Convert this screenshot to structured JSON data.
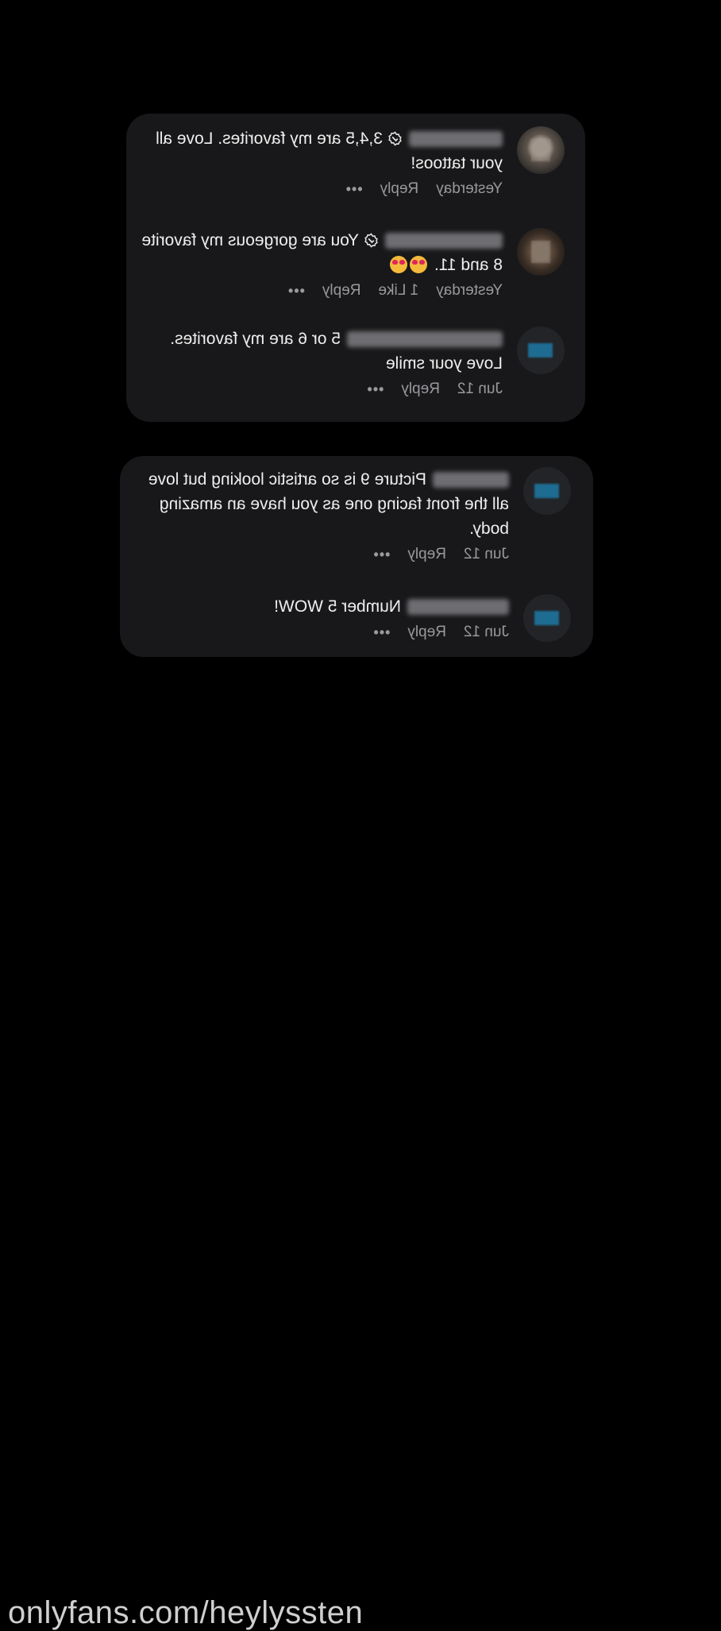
{
  "cards": [
    {
      "comments": [
        {
          "avatar": "photo1",
          "verified": true,
          "text_main": "3,4,5 are my favorites. Love all your tattoos!",
          "emoji_count": 0,
          "time": "Yesterday",
          "likes": "",
          "reply": "Reply",
          "more": "•••"
        },
        {
          "avatar": "photo2",
          "verified": true,
          "text_main": "You are gorgeous my favorite 8 and 11.",
          "emoji_count": 2,
          "time": "Yesterday",
          "likes": "1 Like",
          "reply": "Reply",
          "more": "•••"
        },
        {
          "avatar": "default",
          "verified": false,
          "text_main": "5 or 6 are my favorites. Love your smile",
          "emoji_count": 0,
          "time": "Jun 12",
          "likes": "",
          "reply": "Reply",
          "more": "•••"
        }
      ]
    },
    {
      "comments": [
        {
          "avatar": "default",
          "verified": false,
          "text_main": "Picture 9 is so artistic looking but love all the front facing one as you have an amazing body.",
          "emoji_count": 0,
          "time": "Jun 12",
          "likes": "",
          "reply": "Reply",
          "more": "•••"
        },
        {
          "avatar": "default",
          "verified": false,
          "text_main": "Number 5 WOW!",
          "emoji_count": 0,
          "time": "Jun 12",
          "likes": "",
          "reply": "Reply",
          "more": "•••"
        }
      ]
    }
  ],
  "watermark": "onlyfans.com/heylyssten",
  "colors": {
    "background": "#000000",
    "card": "#18181a",
    "text": "#f0f0f0",
    "meta": "#9a9a9e",
    "avatar_accent": "#1f6c92"
  }
}
